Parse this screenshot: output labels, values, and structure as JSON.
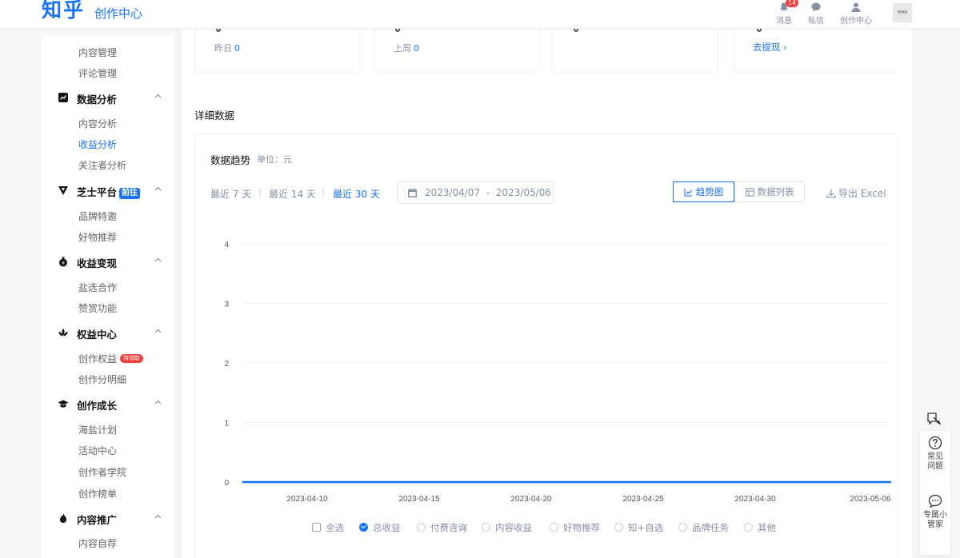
{
  "header": {
    "logo": "知乎",
    "subtitle": "创作中心",
    "icons": [
      {
        "name": "bell-icon",
        "label": "消息",
        "badge": "14"
      },
      {
        "name": "chat-icon",
        "label": "私信"
      },
      {
        "name": "user-icon",
        "label": "创作中心"
      }
    ],
    "avatar_text": "MMM"
  },
  "sidebar": {
    "items": [
      {
        "type": "sub",
        "label": "内容管理"
      },
      {
        "type": "sub",
        "label": "评论管理"
      },
      {
        "type": "group",
        "label": "数据分析",
        "icon": "chart-icon"
      },
      {
        "type": "sub",
        "label": "内容分析"
      },
      {
        "type": "sub",
        "label": "收益分析",
        "active": true
      },
      {
        "type": "sub",
        "label": "关注者分析"
      },
      {
        "type": "group",
        "label": "芝士平台",
        "icon": "cheese-icon",
        "tag": "前往"
      },
      {
        "type": "sub",
        "label": "品牌特邀"
      },
      {
        "type": "sub",
        "label": "好物推荐"
      },
      {
        "type": "group",
        "label": "收益变现",
        "icon": "money-bag-icon"
      },
      {
        "type": "sub",
        "label": "盐选合作"
      },
      {
        "type": "sub",
        "label": "赞赏功能"
      },
      {
        "type": "group",
        "label": "权益中心",
        "icon": "lotus-icon"
      },
      {
        "type": "sub",
        "label": "创作权益",
        "tag": "待领取"
      },
      {
        "type": "sub",
        "label": "创作分明细"
      },
      {
        "type": "group",
        "label": "创作成长",
        "icon": "grad-cap-icon"
      },
      {
        "type": "sub",
        "label": "海盐计划"
      },
      {
        "type": "sub",
        "label": "活动中心"
      },
      {
        "type": "sub",
        "label": "创作者学院"
      },
      {
        "type": "sub",
        "label": "创作榜单"
      },
      {
        "type": "group",
        "label": "内容推广",
        "icon": "flame-icon"
      },
      {
        "type": "sub",
        "label": "内容自荐"
      }
    ]
  },
  "stats": {
    "yesterday": {
      "label": "昨日",
      "value": "0"
    },
    "last_week": {
      "label": "上周",
      "value": "0"
    },
    "withdraw_link": "去提现"
  },
  "detail": {
    "title": "详细数据",
    "trend_title": "数据趋势",
    "unit": "单位：元",
    "ranges": [
      {
        "label": "最近 7 天",
        "active": false
      },
      {
        "label": "最近 14 天",
        "active": false
      },
      {
        "label": "最近 30 天",
        "active": true
      }
    ],
    "date_start": "2023/04/07",
    "date_sep": "-",
    "date_end": "2023/05/06",
    "view_trend": "趋势图",
    "view_list": "数据列表",
    "export": "导出 Excel"
  },
  "chart_data": {
    "type": "line",
    "ylim": [
      0,
      4
    ],
    "yticks": [
      "0",
      "1",
      "2",
      "3",
      "4"
    ],
    "xticks": [
      "2023-04-10",
      "2023-04-15",
      "2023-04-20",
      "2023-04-25",
      "2023-04-30",
      "2023-05-06"
    ],
    "x": [
      "2023-04-07",
      "2023-05-06"
    ],
    "series": [
      {
        "name": "总收益",
        "values": [
          0,
          0
        ],
        "color": "#1772f6"
      }
    ],
    "grid": true
  },
  "legend": [
    {
      "label": "全选",
      "kind": "checkbox",
      "on": false
    },
    {
      "label": "总收益",
      "kind": "radio",
      "on": true
    },
    {
      "label": "付费咨询",
      "kind": "radio",
      "on": false
    },
    {
      "label": "内容收益",
      "kind": "radio",
      "on": false
    },
    {
      "label": "好物推荐",
      "kind": "radio",
      "on": false
    },
    {
      "label": "知+自选",
      "kind": "radio",
      "on": false
    },
    {
      "label": "品牌任务",
      "kind": "radio",
      "on": false
    },
    {
      "label": "其他",
      "kind": "radio",
      "on": false
    }
  ],
  "float": {
    "faq": "常见问题",
    "assistant": "专属小管家"
  }
}
